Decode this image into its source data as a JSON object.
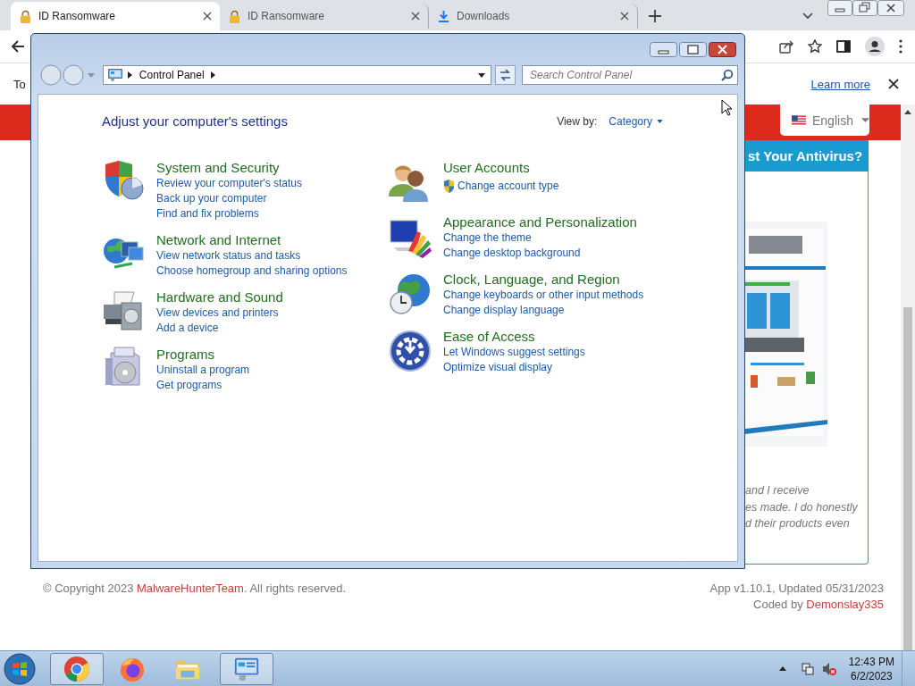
{
  "browser": {
    "tabs": [
      {
        "title": "ID Ransomware",
        "kind": "lock",
        "selected": true
      },
      {
        "title": "ID Ransomware",
        "kind": "lock",
        "selected": false
      },
      {
        "title": "Downloads",
        "kind": "download",
        "selected": false
      }
    ]
  },
  "infobar": {
    "text": "To",
    "link": "Learn more"
  },
  "page": {
    "language": "English",
    "card_title": "st Your Antivirus?",
    "card_lines": [
      "and I receive",
      "es made. I do honestly",
      "d their products even"
    ],
    "footer": {
      "copyright_before": "© Copyright 2023 ",
      "copyright_link": "MalwareHunterTeam",
      "copyright_after": ". All rights reserved.",
      "version": "App v1.10.1, Updated 05/31/2023",
      "coded_by": "Coded by ",
      "coded_by_link": "Demonslay335"
    }
  },
  "control_panel": {
    "address": "Control Panel",
    "search_placeholder": "Search Control Panel",
    "heading": "Adjust your computer's settings",
    "view_by_label": "View by:",
    "view_by_value": "Category",
    "columns": [
      [
        {
          "title": "System and Security",
          "kind": "security",
          "links": [
            {
              "text": "Review your computer's status",
              "shield": false
            },
            {
              "text": "Back up your computer",
              "shield": false
            },
            {
              "text": "Find and fix problems",
              "shield": false
            }
          ]
        },
        {
          "title": "Network and Internet",
          "kind": "network",
          "links": [
            {
              "text": "View network status and tasks",
              "shield": false
            },
            {
              "text": "Choose homegroup and sharing options",
              "shield": false
            }
          ]
        },
        {
          "title": "Hardware and Sound",
          "kind": "hardware",
          "links": [
            {
              "text": "View devices and printers",
              "shield": false
            },
            {
              "text": "Add a device",
              "shield": false
            }
          ]
        },
        {
          "title": "Programs",
          "kind": "programs",
          "links": [
            {
              "text": "Uninstall a program",
              "shield": false
            },
            {
              "text": "Get programs",
              "shield": false
            }
          ]
        }
      ],
      [
        {
          "title": "User Accounts",
          "kind": "users",
          "links": [
            {
              "text": "Change account type",
              "shield": true
            }
          ]
        },
        {
          "title": "Appearance and Personalization",
          "kind": "appearance",
          "links": [
            {
              "text": "Change the theme",
              "shield": false
            },
            {
              "text": "Change desktop background",
              "shield": false
            }
          ]
        },
        {
          "title": "Clock, Language, and Region",
          "kind": "clock",
          "links": [
            {
              "text": "Change keyboards or other input methods",
              "shield": false
            },
            {
              "text": "Change display language",
              "shield": false
            }
          ]
        },
        {
          "title": "Ease of Access",
          "kind": "ease",
          "links": [
            {
              "text": "Let Windows suggest settings",
              "shield": false
            },
            {
              "text": "Optimize visual display",
              "shield": false
            }
          ]
        }
      ]
    ]
  },
  "taskbar": {
    "apps": [
      {
        "kind": "chrome",
        "active": true
      },
      {
        "kind": "firefox",
        "active": false
      },
      {
        "kind": "explorer",
        "active": false
      },
      {
        "kind": "control-panel",
        "active": true
      }
    ],
    "time": "12:43 PM",
    "date": "6/2/2023"
  }
}
